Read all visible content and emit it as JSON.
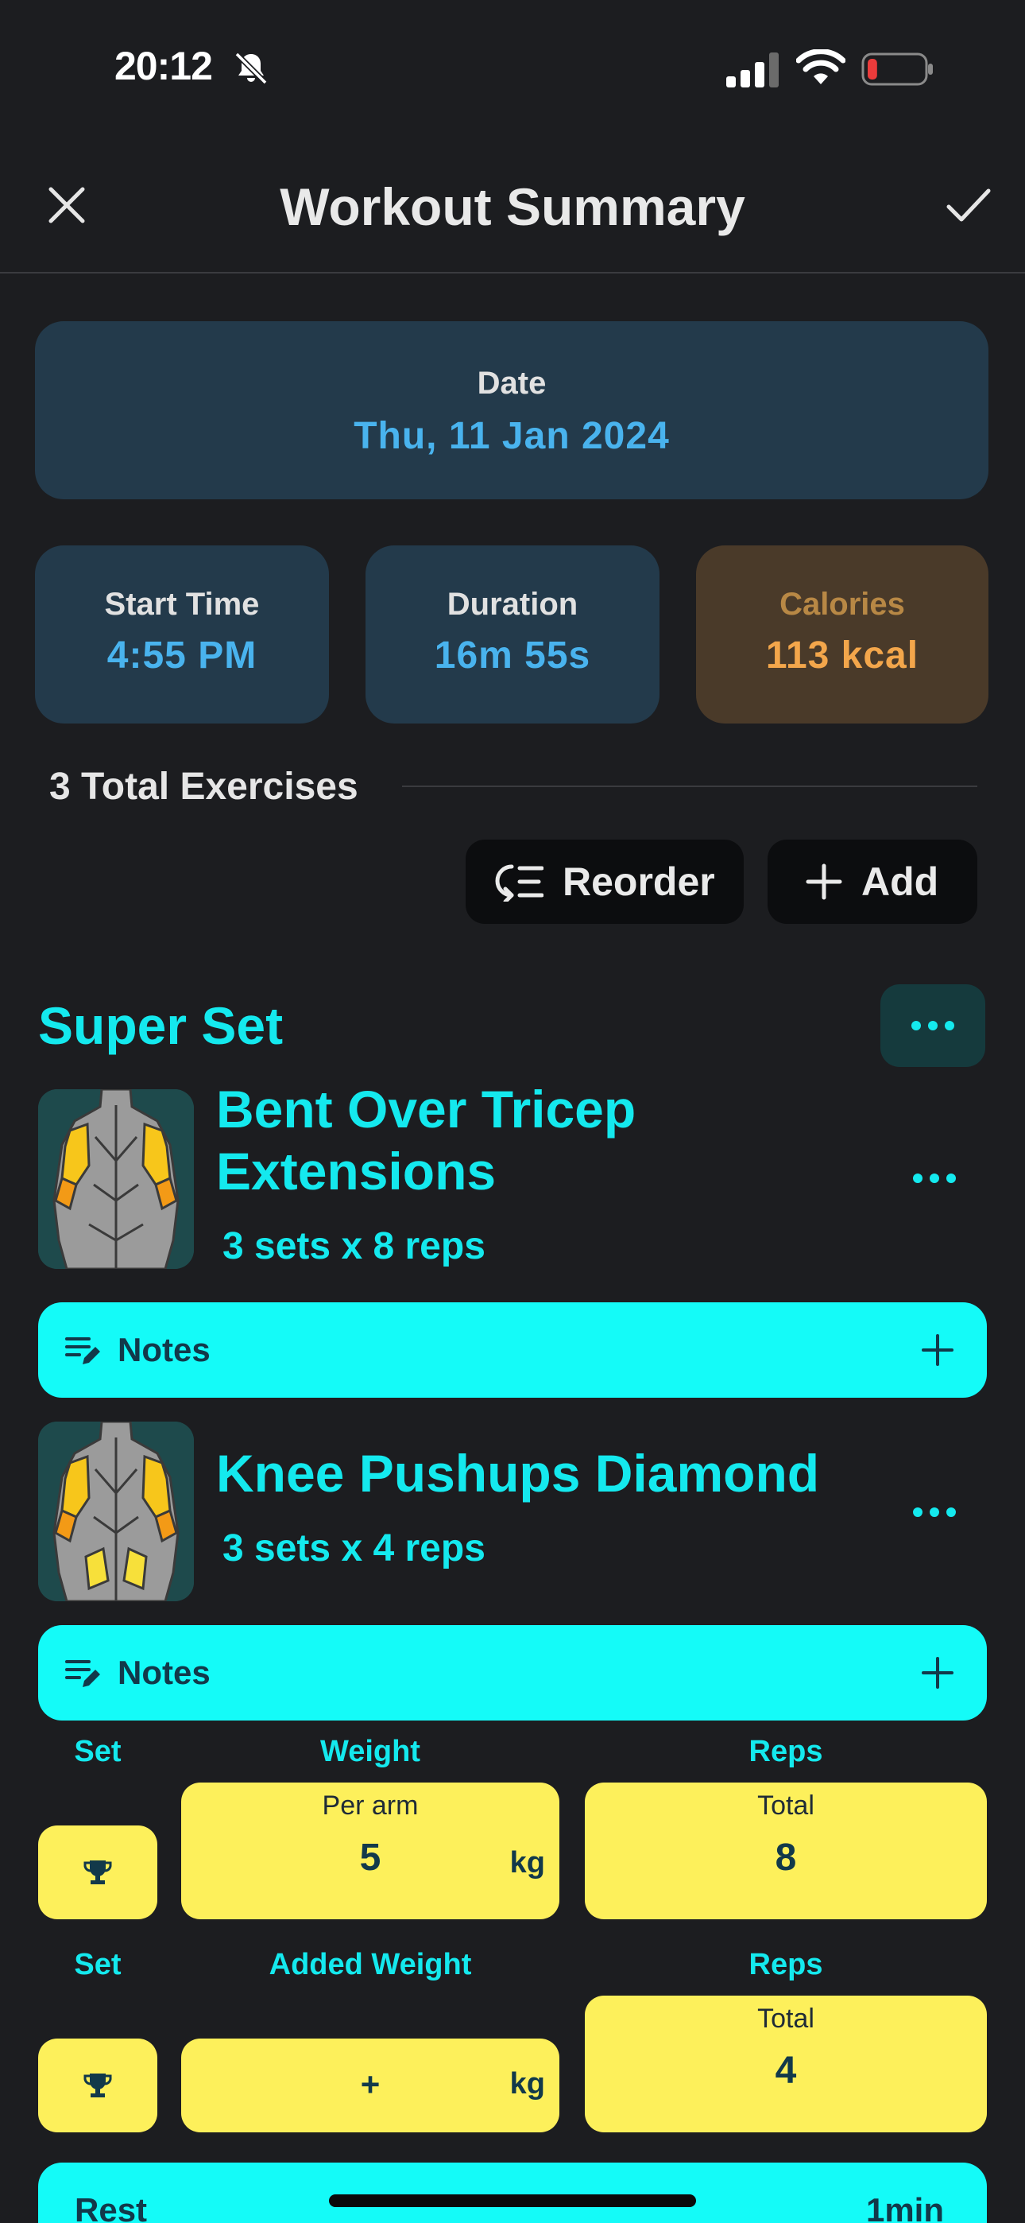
{
  "status_bar": {
    "time": "20:12",
    "battery_level": 0.1,
    "icons": [
      "bell-muted-icon",
      "signal-icon",
      "wifi-icon",
      "battery-icon"
    ]
  },
  "header": {
    "title": "Workout Summary",
    "close_icon": "close-icon",
    "confirm_icon": "check-icon"
  },
  "summary": {
    "date_label": "Date",
    "date_value": "Thu, 11 Jan 2024",
    "start_label": "Start Time",
    "start_value": "4:55 PM",
    "duration_label": "Duration",
    "duration_value": "16m 55s",
    "calories_label": "Calories",
    "calories_value": "113 kcal"
  },
  "exercises_header": {
    "total_label": "3 Total Exercises",
    "reorder_label": "Reorder",
    "add_label": "Add"
  },
  "superset": {
    "title": "Super Set",
    "exercises": [
      {
        "name": "Bent Over Tricep Extensions",
        "summary": "3 sets x 8 reps",
        "notes_label": "Notes"
      },
      {
        "name": "Knee Pushups Diamond",
        "summary": "3 sets x 4 reps",
        "notes_label": "Notes"
      }
    ],
    "sets": [
      {
        "set_header": "Set",
        "weight_header": "Weight",
        "reps_header": "Reps",
        "weight_sublabel": "Per arm",
        "weight_value": "5",
        "unit": "kg",
        "reps_sublabel": "Total",
        "reps_value": "8"
      },
      {
        "set_header": "Set",
        "weight_header": "Added Weight",
        "reps_header": "Reps",
        "weight_value": "+",
        "unit": "kg",
        "reps_sublabel": "Total",
        "reps_value": "4"
      }
    ],
    "rest": {
      "label": "Rest",
      "value": "1min"
    }
  },
  "colors": {
    "accent": "#14e9ee",
    "notes_bg": "#14fbf8",
    "set_bg": "#fdf05b",
    "card_bg": "#233a4b",
    "calories_bg": "#4a3a29"
  }
}
